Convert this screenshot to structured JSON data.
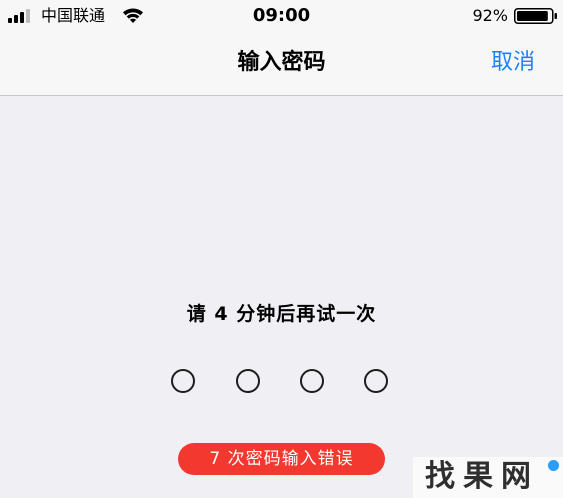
{
  "status_bar": {
    "carrier": "中国联通",
    "time": "09:00",
    "battery_percent": "92%",
    "battery_level": 0.92,
    "signal_bars_filled": 3,
    "signal_bars_total": 4,
    "icons": [
      "signal-bars-icon",
      "wifi-icon",
      "battery-icon"
    ]
  },
  "nav_bar": {
    "title": "输入密码",
    "cancel_label": "取消"
  },
  "lockout": {
    "message": "请 4 分钟后再试一次",
    "passcode_dots": 4,
    "failed_attempts_label": "7 次密码输入错误"
  },
  "watermark": {
    "text": "找果网"
  },
  "colors": {
    "background": "#efeff4",
    "bar_background": "#f7f7f7",
    "accent_blue": "#1a82fb",
    "alert_red": "#f2382f",
    "dot_stroke": "#1c1c1c"
  }
}
